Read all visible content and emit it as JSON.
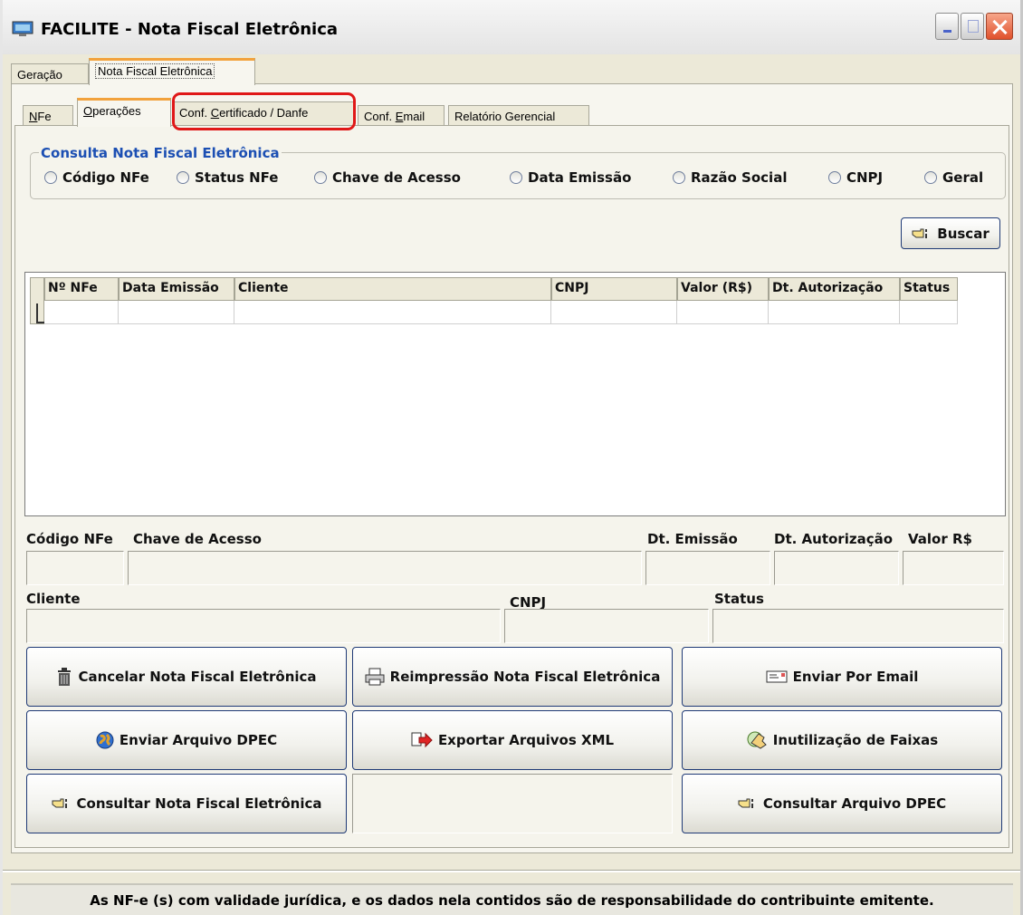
{
  "window": {
    "title": "FACILITE - Nota Fiscal Eletrônica"
  },
  "outer_tabs": [
    {
      "label": "Geração"
    },
    {
      "label": "Nota Fiscal Eletrônica",
      "active": true
    }
  ],
  "inner_tabs": [
    {
      "prefix": "",
      "mnemonic": "N",
      "suffix": "Fe"
    },
    {
      "prefix": "",
      "mnemonic": "O",
      "suffix": "perações",
      "active": true
    },
    {
      "prefix": "Conf. ",
      "mnemonic": "C",
      "suffix": "ertificado / Danfe"
    },
    {
      "prefix": "Conf. ",
      "mnemonic": "E",
      "suffix": "mail"
    },
    {
      "prefix": "",
      "mnemonic": "",
      "suffix": "Relatório Gerencial"
    }
  ],
  "search_group": {
    "title": "Consulta Nota Fiscal Eletrônica",
    "options": [
      "Código NFe",
      "Status NFe",
      "Chave de Acesso",
      "Data Emissão",
      "Razão Social",
      "CNPJ",
      "Geral"
    ]
  },
  "buscar_button": "Buscar",
  "grid": {
    "columns": [
      "Nº NFe",
      "Data Emissão",
      "Cliente",
      "CNPJ",
      "Valor (R$)",
      "Dt. Autorização",
      "Status"
    ]
  },
  "details": {
    "codigo": "Código NFe",
    "chave": "Chave de Acesso",
    "dt_emissao": "Dt. Emissão",
    "dt_autorizacao": "Dt. Autorização",
    "valor": "Valor R$",
    "cliente": "Cliente",
    "cnpj": "CNPJ",
    "status": "Status"
  },
  "actions": {
    "cancelar": "Cancelar Nota Fiscal Eletrônica",
    "reimpressao": "Reimpressão Nota Fiscal Eletrônica",
    "email": "Enviar Por Email",
    "dpec": "Enviar Arquivo DPEC",
    "exportar": "Exportar Arquivos XML",
    "inutilizacao": "Inutilização de Faixas",
    "consultar_nfe": "Consultar Nota Fiscal Eletrônica",
    "consultar_dpec": "Consultar Arquivo DPEC"
  },
  "footer": "As NF-e (s) com validade jurídica, e os dados nela contidos são de responsabilidade do contribuinte emitente.",
  "icons": {
    "app": "monitor-icon",
    "buscar": "pointing-hand-icon",
    "cancelar": "trash-can-icon",
    "reimpressao": "printer-icon",
    "email": "envelope-icon",
    "dpec": "globe-icon",
    "exportar": "export-arrow-icon",
    "inutilizacao": "disk-hand-icon"
  },
  "colors": {
    "group_title": "#1c4fb3",
    "highlight": "#e01818",
    "active_tab": "#f2a23c"
  }
}
